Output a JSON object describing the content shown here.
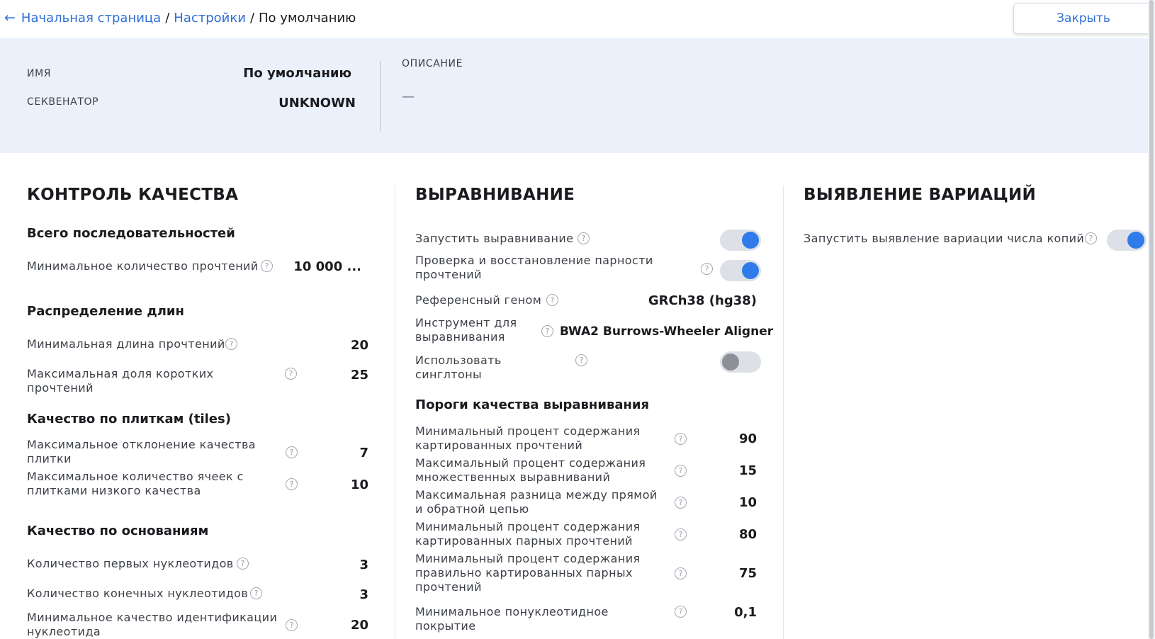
{
  "breadcrumb": {
    "back_icon": "←",
    "home": "Начальная страница",
    "separator": "/",
    "settings": "Настройки",
    "current": "По умолчанию"
  },
  "close_label": "Закрыть",
  "info": {
    "name_label": "ИМЯ",
    "name_value": "По умолчанию",
    "sequencer_label": "СЕКВЕНАТОР",
    "sequencer_value": "UNKNOWN",
    "description_label": "ОПИСАНИЕ",
    "description_value": "—"
  },
  "qc": {
    "title": "КОНТРОЛЬ КАЧЕСТВА",
    "groups": [
      {
        "title": "Всего последовательностей",
        "rows": [
          {
            "label": "Минимальное количество прочтений",
            "value": "10 000 ..."
          }
        ]
      },
      {
        "title": "Распределение длин",
        "rows": [
          {
            "label": "Минимальная длина прочтений",
            "value": "20"
          },
          {
            "label": "Максимальная доля коротких прочтений",
            "value": "25"
          }
        ]
      },
      {
        "title": "Качество по плиткам (tiles)",
        "rows": [
          {
            "label": "Максимальное отклонение качества плитки",
            "value": "7"
          },
          {
            "label": "Максимальное количество ячеек с плитками низкого качества",
            "value": "10"
          }
        ]
      },
      {
        "title": "Качество по основаниям",
        "rows": [
          {
            "label": "Количество первых нуклеотидов",
            "value": "3"
          },
          {
            "label": "Количество конечных нуклеотидов",
            "value": "3"
          },
          {
            "label": "Минимальное качество идентификации нуклеотида",
            "value": "20"
          }
        ]
      }
    ]
  },
  "alignment": {
    "title": "ВЫРАВНИВАНИЕ",
    "rows": [
      {
        "label": "Запустить выравнивание",
        "toggle": true
      },
      {
        "label": "Проверка и восстановление парности прочтений",
        "toggle": true
      },
      {
        "label": "Референсный геном",
        "value": "GRCh38 (hg38)"
      },
      {
        "label": "Инструмент для выравнивания",
        "value": "BWA2 Burrows-Wheeler Aligner"
      },
      {
        "label": "Использовать синглтоны",
        "toggle": false
      }
    ],
    "thresholds_title": "Пороги качества выравнивания",
    "thresholds": [
      {
        "label": "Минимальный процент содержания картированных прочтений",
        "value": "90"
      },
      {
        "label": "Максимальный процент содержания множественных выравниваний",
        "value": "15"
      },
      {
        "label": "Максимальная разница между прямой и обратной цепью",
        "value": "10"
      },
      {
        "label": "Минимальный процент содержания картированных парных прочтений",
        "value": "80"
      },
      {
        "label": "Минимальный процент содержания правильно картированных парных прочтений",
        "value": "75"
      },
      {
        "label": "Минимальное понуклеотидное покрытие",
        "value": "0,1"
      }
    ]
  },
  "variants": {
    "title": "ВЫЯВЛЕНИЕ ВАРИАЦИЙ",
    "rows": [
      {
        "label": "Запустить выявление вариации числа копий",
        "toggle": true
      }
    ]
  },
  "help_glyph": "?",
  "colors": {
    "accent": "#2f7bea",
    "link": "#2f6fd8",
    "info_bg": "#eaf1fb"
  }
}
